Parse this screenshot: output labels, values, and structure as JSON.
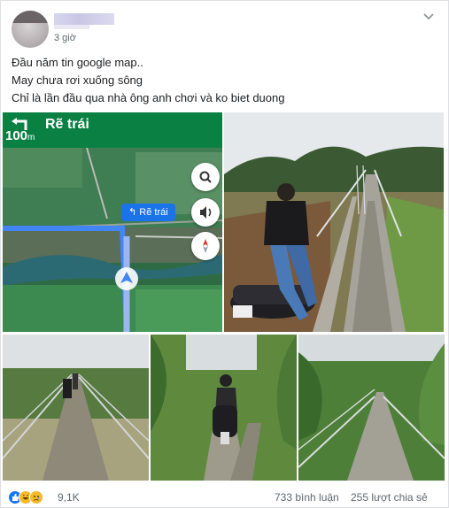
{
  "post": {
    "time": "3 giờ",
    "text_lines": [
      "Đầu năm tin google map..",
      "May chưa rơi xuống sông",
      "Chỉ là lần đầu qua nhà ông anh chơi và ko biet duong"
    ]
  },
  "map": {
    "direction": "Rẽ trái",
    "distance_value": "100",
    "distance_unit": "m",
    "chip_label": "Rẽ trái",
    "colors": {
      "header": "#0b8043",
      "route": "#4285f4"
    }
  },
  "reactions": {
    "types": [
      "like-icon",
      "haha-icon",
      "sad-icon"
    ],
    "count": "9,1K"
  },
  "stats": {
    "comments": "733 bình luận",
    "shares": "255 lượt chia sẻ"
  }
}
